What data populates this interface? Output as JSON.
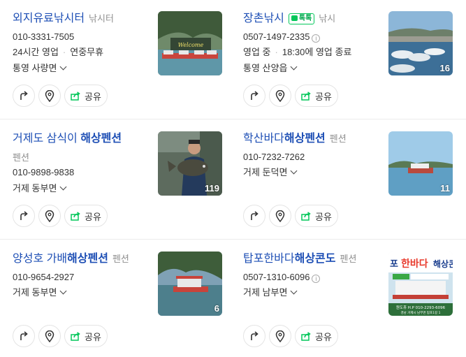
{
  "listings": [
    {
      "name_plain": "외지유료낚시터",
      "name_highlight": "",
      "category": "낚시터",
      "talktalk": "",
      "category_line": "",
      "phone": "010-3331-7505",
      "show_info_icon": false,
      "hours": "24시간 영업",
      "hours_extra": "연중무휴",
      "address": "통영 사량면",
      "photo_count": ""
    },
    {
      "name_plain": "장촌낚시",
      "name_highlight": "",
      "category": "낚시",
      "talktalk": "톡톡",
      "category_line": "",
      "phone": "0507-1497-2335",
      "show_info_icon": true,
      "hours": "영업 중",
      "hours_extra": "18:30에 영업 종료",
      "address": "통영 산양읍",
      "photo_count": "16"
    },
    {
      "name_plain": "거제도 삼식이 ",
      "name_highlight": "해상펜션",
      "category": "",
      "talktalk": "",
      "category_line": "펜션",
      "phone": "010-9898-9838",
      "show_info_icon": false,
      "hours": "",
      "hours_extra": "",
      "address": "거제 동부면",
      "photo_count": "119"
    },
    {
      "name_plain": "학산바다",
      "name_highlight": "해상펜션",
      "category": "펜션",
      "talktalk": "",
      "category_line": "",
      "phone": "010-7232-7262",
      "show_info_icon": false,
      "hours": "",
      "hours_extra": "",
      "address": "거제 둔덕면",
      "photo_count": "11"
    },
    {
      "name_plain": "양성호 가배",
      "name_highlight": "해상펜션",
      "category": "펜션",
      "talktalk": "",
      "category_line": "",
      "phone": "010-9654-2927",
      "show_info_icon": false,
      "hours": "",
      "hours_extra": "",
      "address": "거제 동부면",
      "photo_count": "6"
    },
    {
      "name_plain": "탑포한바다",
      "name_highlight": "해상콘도",
      "category": "펜션",
      "talktalk": "",
      "category_line": "",
      "phone": "0507-1310-6096",
      "show_info_icon": true,
      "hours": "",
      "hours_extra": "",
      "address": "거제 남부면",
      "photo_count": ""
    }
  ],
  "actions": {
    "share_label": "공유"
  },
  "thumb_texts": {
    "welcome": "Welcome",
    "banner_pre": "포",
    "banner_main": "한바다",
    "banner_post": "해상콘",
    "banner_phone": "원도휴 H.P 010-2293-6096",
    "banner_addr": "경남 거제시 남부면 탑포1길 1"
  },
  "colors": {
    "title": "#1e4fb5",
    "accent_green": "#03c75a",
    "muted": "#8f8f8f"
  },
  "icons": {
    "route": "route-arrow-icon",
    "map": "map-pin-icon",
    "share": "share-icon",
    "talk": "talktalk-badge-icon",
    "info": "info-icon",
    "chevron": "chevron-down-icon"
  }
}
